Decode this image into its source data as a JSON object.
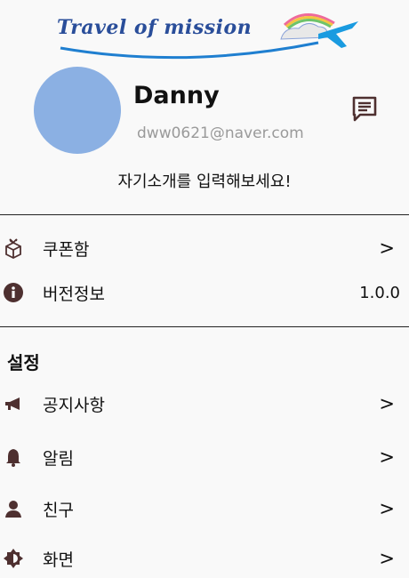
{
  "header": {
    "logo_text": "Travel of mission",
    "logo_icon": "airplane-icon"
  },
  "profile": {
    "name": "Danny",
    "email": "dww0621@naver.com",
    "intro": "자기소개를 입력해보세요!",
    "edit_icon": "edit-message-icon",
    "avatar_color": "#8bb0e3"
  },
  "menu": {
    "items": [
      {
        "label": "쿠폰함",
        "icon": "gift-box-icon",
        "action": ">"
      },
      {
        "label": "버전정보",
        "icon": "info-icon",
        "value": "1.0.0"
      }
    ]
  },
  "settings": {
    "title": "설정",
    "items": [
      {
        "label": "공지사항",
        "icon": "megaphone-icon",
        "action": ">"
      },
      {
        "label": "알림",
        "icon": "bell-icon",
        "action": ">"
      },
      {
        "label": "친구",
        "icon": "person-icon",
        "action": ">"
      },
      {
        "label": "화면",
        "icon": "brightness-icon",
        "action": ">"
      }
    ]
  },
  "colors": {
    "icon_brown": "#4e3030",
    "logo_blue": "#1f7fd0",
    "logo_navy": "#2a4e9a"
  }
}
